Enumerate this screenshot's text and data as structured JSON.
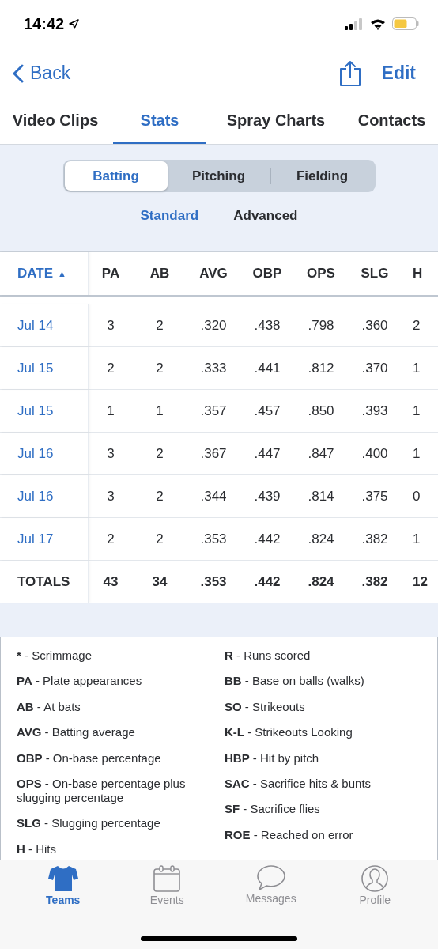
{
  "status_bar": {
    "time": "14:42"
  },
  "nav": {
    "back": "Back",
    "edit": "Edit"
  },
  "tabs": [
    {
      "label": "Video Clips",
      "selected": false
    },
    {
      "label": "Stats",
      "selected": true
    },
    {
      "label": "Spray Charts",
      "selected": false
    },
    {
      "label": "Contacts",
      "selected": false
    }
  ],
  "segments": [
    {
      "label": "Batting",
      "selected": true
    },
    {
      "label": "Pitching",
      "selected": false
    },
    {
      "label": "Fielding",
      "selected": false
    }
  ],
  "views": [
    {
      "label": "Standard",
      "selected": true
    },
    {
      "label": "Advanced",
      "selected": false
    }
  ],
  "table": {
    "columns": [
      "DATE",
      "PA",
      "AB",
      "AVG",
      "OBP",
      "OPS",
      "SLG",
      "H"
    ],
    "sort_mark": "▲",
    "rows": [
      [
        "Jul 14",
        "3",
        "2",
        ".320",
        ".438",
        ".798",
        ".360",
        "2"
      ],
      [
        "Jul 15",
        "2",
        "2",
        ".333",
        ".441",
        ".812",
        ".370",
        "1"
      ],
      [
        "Jul 15",
        "1",
        "1",
        ".357",
        ".457",
        ".850",
        ".393",
        "1"
      ],
      [
        "Jul 16",
        "3",
        "2",
        ".367",
        ".447",
        ".847",
        ".400",
        "1"
      ],
      [
        "Jul 16",
        "3",
        "2",
        ".344",
        ".439",
        ".814",
        ".375",
        "0"
      ],
      [
        "Jul 17",
        "2",
        "2",
        ".353",
        ".442",
        ".824",
        ".382",
        "1"
      ]
    ],
    "totals": [
      "TOTALS",
      "43",
      "34",
      ".353",
      ".442",
      ".824",
      ".382",
      "12"
    ]
  },
  "legend": {
    "left": [
      {
        "abbr": "*",
        "text": " - Scrimmage"
      },
      {
        "abbr": "PA",
        "text": " - Plate appearances"
      },
      {
        "abbr": "AB",
        "text": " - At bats"
      },
      {
        "abbr": "AVG",
        "text": " - Batting average"
      },
      {
        "abbr": "OBP",
        "text": " - On-base percentage"
      },
      {
        "abbr": "OPS",
        "text": " - On-base percentage plus slugging percentage"
      },
      {
        "abbr": "SLG",
        "text": " - Slugging percentage"
      },
      {
        "abbr": "H",
        "text": " - Hits"
      }
    ],
    "right": [
      {
        "abbr": "R",
        "text": " - Runs scored"
      },
      {
        "abbr": "BB",
        "text": " - Base on balls (walks)"
      },
      {
        "abbr": "SO",
        "text": " - Strikeouts"
      },
      {
        "abbr": "K-L",
        "text": " - Strikeouts Looking"
      },
      {
        "abbr": "HBP",
        "text": " - Hit by pitch"
      },
      {
        "abbr": "SAC",
        "text": " - Sacrifice hits & bunts"
      },
      {
        "abbr": "SF",
        "text": " - Sacrifice flies"
      },
      {
        "abbr": "ROE",
        "text": " - Reached on error"
      }
    ]
  },
  "tab_bar": [
    {
      "label": "Teams",
      "selected": true
    },
    {
      "label": "Events",
      "selected": false
    },
    {
      "label": "Messages",
      "selected": false
    },
    {
      "label": "Profile",
      "selected": false
    }
  ]
}
